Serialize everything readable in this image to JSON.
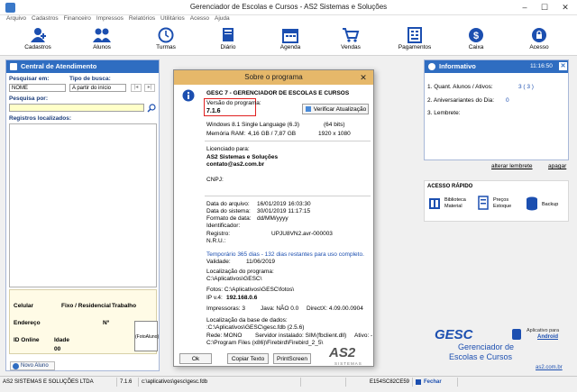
{
  "window": {
    "title": "Gerenciador de Escolas e Cursos - AS2 Sistemas e Soluções",
    "min": "–",
    "max": "☐",
    "close": "✕"
  },
  "menu": [
    "Arquivo",
    "Cadastros",
    "Financeiro",
    "Impressos",
    "Relatórios",
    "Utilitários",
    "Acesso",
    "Ajuda"
  ],
  "toolbar": [
    {
      "label": "Cadastros",
      "icon": "user-plus-icon"
    },
    {
      "label": "Alunos",
      "icon": "students-icon"
    },
    {
      "label": "Turmas",
      "icon": "clock-icon"
    },
    {
      "label": "Diário",
      "icon": "book-icon"
    },
    {
      "label": "Agenda",
      "icon": "calendar-icon"
    },
    {
      "label": "Vendas",
      "icon": "cart-icon"
    },
    {
      "label": "Pagamentos",
      "icon": "ledger-icon"
    },
    {
      "label": "Caixa",
      "icon": "dollar-icon"
    },
    {
      "label": "Acesso",
      "icon": "lock-icon"
    }
  ],
  "central": {
    "title": "Central de Atendimento",
    "pesquisar_em_label": "Pesquisar em:",
    "pesquisar_em_value": "NOME",
    "tipo_busca_label": "Tipo de busca:",
    "tipo_busca_value": "A partir do início",
    "pesquisa_por_label": "Pesquisa por:",
    "registros_label": "Registros localizados:",
    "celular": "Celular",
    "fixo": "Fixo / Residencial",
    "trabalho": "Trabalho",
    "endereco": "Endereço",
    "numero": "Nº",
    "id_online": "ID Online",
    "idade": "Idade",
    "idade_value": "00",
    "foto": "(FotoAluno)",
    "novo_aluno": "Novo Aluno"
  },
  "dialog": {
    "title": "Sobre o programa",
    "close": "✕",
    "product": "GESC 7 - GERENCIADOR DE ESCOLAS E CURSOS",
    "versao_label": "Versão do programa:",
    "versao_value": "7.1.6",
    "verificar": "Verificar Atualização",
    "os": "Windows 8.1 Single Language (6.3)",
    "bits": "(64 bits)",
    "memoria": "Memória RAM:",
    "memoria_value": "4,16 GB / 7,87 GB",
    "resolucao": "1920 x 1080",
    "licenciado_label": "Licenciado para:",
    "licenciado_nome": "AS2 Sistemas e Soluções",
    "licenciado_email": "contato@as2.com.br",
    "cnpj_label": "CNPJ:",
    "data_arquivo_label": "Data do arquivo:",
    "data_arquivo": "16/01/2019 16:03:30",
    "data_sistema_label": "Data do sistema:",
    "data_sistema": "30/01/2019 11:17:15",
    "formato_label": "Formato de data:",
    "formato": "dd/MM/yyyy",
    "identificador_label": "Identificador:",
    "registro_label": "Registro:",
    "registro": "UPJU8VN2.avr-000003",
    "nru_label": "N.R.U.:",
    "temporario": "Temporário 365 dias - 132 dias restantes para uso completo.",
    "validade_label": "Validade:",
    "validade": "11/06/2019",
    "localizacao_prog_label": "Localização do programa:",
    "localizacao_prog": "C:\\Aplicativos\\GESC\\",
    "fotos": "Fotos: C:\\Aplicativos\\GESC\\fotos\\",
    "ip_label": "IP v.4:",
    "ip": "192.168.0.6",
    "impressoras": "Impressoras: 3",
    "java": "Java: NÃO 0.0",
    "directx": "DirectX: 4.09.00.0904",
    "localizacao_base_label": "Localização da base de dados:",
    "localizacao_base": ":C:\\Aplicativos\\GESC\\gesc.fdb (2.5.6)",
    "rede": "Rede: MONO",
    "servidor": "Servidor instalado: SIM",
    "fbclient": "(fbclient.dll)",
    "ativo": "Ativo: -",
    "firebird": "C:\\Program Files (x86)\\Firebird\\Firebird_2_5\\",
    "ok": "Ok",
    "copiar": "Copiar Texto",
    "print": "PrintScreen",
    "logo": "AS2",
    "logo_sub": "SISTEMAS"
  },
  "informativo": {
    "title": "Informativo",
    "time": "11:16:50",
    "line1_label": "1. Quant. Alunos / Ativos:",
    "line1_value": "3 ( 3 )",
    "line2_label": "2. Aniversariantes do Dia:",
    "line2_value": "0",
    "line3_label": "3. Lembrete:",
    "alterar": "alterar lembrete",
    "apagar": "apagar"
  },
  "acesso_rapido": {
    "title": "ACESSO RÁPIDO",
    "items": [
      {
        "label": "Biblioteca Material",
        "icon": "library-icon"
      },
      {
        "label": "Preços Estoque",
        "icon": "prices-icon"
      },
      {
        "label": "Backup",
        "icon": "database-icon"
      }
    ]
  },
  "branding": {
    "gesc": "GESC",
    "line1": "Gerenciador de",
    "line2": "Escolas e Cursos",
    "app_label": "Aplicativo para",
    "android": "Android",
    "site": "as2.com.br"
  },
  "statusbar": {
    "company": "AS2 SISTEMAS E SOLUÇÕES LTDA",
    "version": "7.1.6",
    "path": "c:\\aplicativos\\gesc\\gesc.fdb",
    "code": "E154SC82CE59",
    "fechar": "Fechar"
  },
  "colors": {
    "accent": "#2f6dc1",
    "dialog_title": "#e6b86a",
    "highlight_box": "#e02020",
    "brand_blue": "#1c4fb0"
  }
}
